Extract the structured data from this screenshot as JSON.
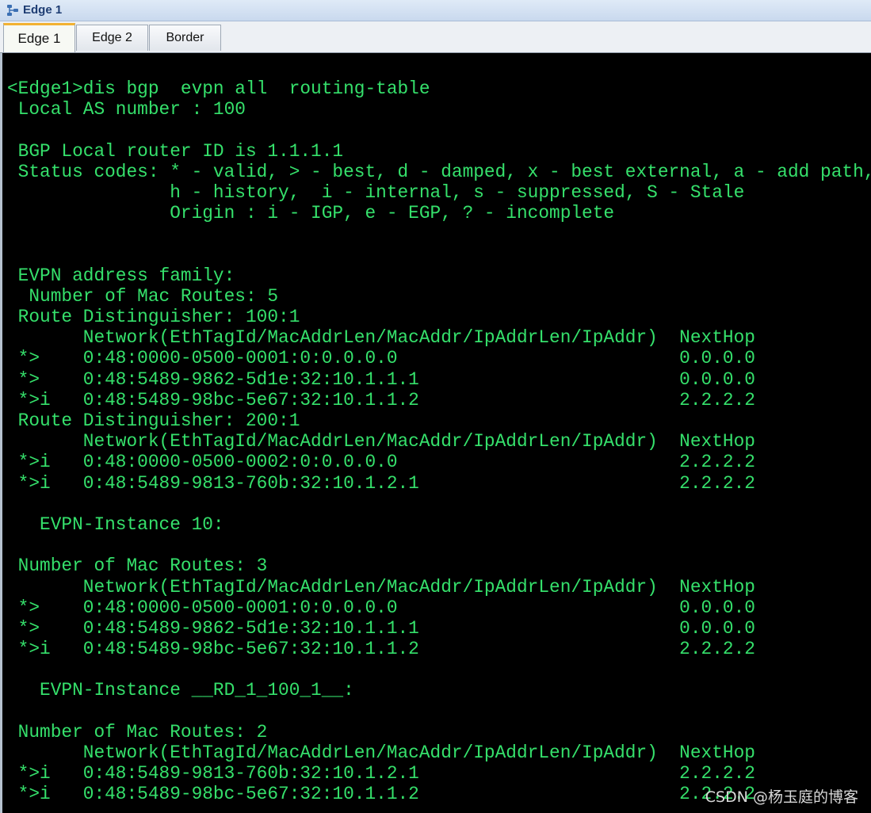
{
  "window": {
    "title": "Edge 1"
  },
  "tabs": [
    {
      "label": "Edge 1",
      "active": true
    },
    {
      "label": "Edge 2",
      "active": false
    },
    {
      "label": "Border",
      "active": false
    }
  ],
  "console": {
    "text_color": "#35e06b",
    "background": "#000000",
    "lines": [
      "<Edge1>dis bgp  evpn all  routing-table",
      " Local AS number : 100",
      "",
      " BGP Local router ID is 1.1.1.1",
      " Status codes: * - valid, > - best, d - damped, x - best external, a - add path,",
      "               h - history,  i - internal, s - suppressed, S - Stale",
      "               Origin : i - IGP, e - EGP, ? - incomplete",
      "",
      "",
      " EVPN address family:",
      "  Number of Mac Routes: 5",
      " Route Distinguisher: 100:1",
      "       Network(EthTagId/MacAddrLen/MacAddr/IpAddrLen/IpAddr)  NextHop",
      " *>    0:48:0000-0500-0001:0:0.0.0.0                          0.0.0.0",
      " *>    0:48:5489-9862-5d1e:32:10.1.1.1                        0.0.0.0",
      " *>i   0:48:5489-98bc-5e67:32:10.1.1.2                        2.2.2.2",
      " Route Distinguisher: 200:1",
      "       Network(EthTagId/MacAddrLen/MacAddr/IpAddrLen/IpAddr)  NextHop",
      " *>i   0:48:0000-0500-0002:0:0.0.0.0                          2.2.2.2",
      " *>i   0:48:5489-9813-760b:32:10.1.2.1                        2.2.2.2",
      "",
      "   EVPN-Instance 10:",
      "",
      " Number of Mac Routes: 3",
      "       Network(EthTagId/MacAddrLen/MacAddr/IpAddrLen/IpAddr)  NextHop",
      " *>    0:48:0000-0500-0001:0:0.0.0.0                          0.0.0.0",
      " *>    0:48:5489-9862-5d1e:32:10.1.1.1                        0.0.0.0",
      " *>i   0:48:5489-98bc-5e67:32:10.1.1.2                        2.2.2.2",
      "",
      "   EVPN-Instance __RD_1_100_1__:",
      "",
      " Number of Mac Routes: 2",
      "       Network(EthTagId/MacAddrLen/MacAddr/IpAddrLen/IpAddr)  NextHop",
      " *>i   0:48:5489-9813-760b:32:10.1.2.1                        2.2.2.2",
      " *>i   0:48:5489-98bc-5e67:32:10.1.1.2                        2.2.2.2"
    ]
  },
  "watermark": {
    "text": "CSDN @杨玉庭的博客"
  },
  "icons": {
    "title_icon": "network-topology-icon"
  }
}
